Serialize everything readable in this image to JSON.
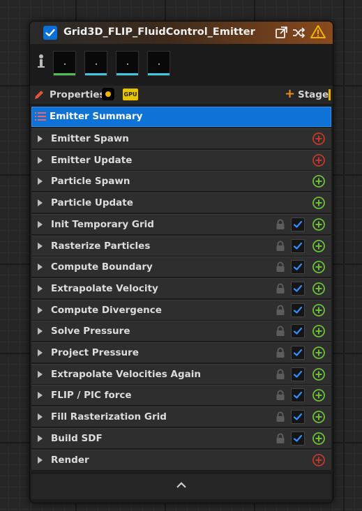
{
  "node": {
    "title": "Grid3D_FLIP_FluidControl_Emitter",
    "enabled": true,
    "header_icons": [
      "open-external-icon",
      "shuffle-icon",
      "warning-icon"
    ],
    "accent_color": "#0f72d6",
    "warning_color": "#f0b400"
  },
  "preview": {
    "person_icon": "person-icon",
    "textures": [
      {
        "bar_color": "#4fc04f"
      },
      {
        "bar_color": "#3fc6e0"
      },
      {
        "bar_color": "#3fc6e0"
      },
      {
        "bar_color": "#3fc6e0"
      }
    ]
  },
  "properties_bar": {
    "properties_label": "Properties",
    "gpu_badge": "GPU",
    "stage_label": "Stage"
  },
  "summary": {
    "label": "Emitter Summary"
  },
  "groups": [
    {
      "label": "Emitter Spawn",
      "add_color": "#c0392b",
      "lock": false,
      "checked": false
    },
    {
      "label": "Emitter Update",
      "add_color": "#c0392b",
      "lock": false,
      "checked": false
    },
    {
      "label": "Particle Spawn",
      "add_color": "#6dbf3a",
      "lock": false,
      "checked": false
    },
    {
      "label": "Particle Update",
      "add_color": "#6dbf3a",
      "lock": false,
      "checked": false
    },
    {
      "label": "Init Temporary Grid",
      "add_color": "#6dbf3a",
      "lock": true,
      "checked": true
    },
    {
      "label": "Rasterize Particles",
      "add_color": "#6dbf3a",
      "lock": true,
      "checked": true
    },
    {
      "label": "Compute Boundary",
      "add_color": "#6dbf3a",
      "lock": true,
      "checked": true
    },
    {
      "label": "Extrapolate Velocity",
      "add_color": "#6dbf3a",
      "lock": true,
      "checked": true
    },
    {
      "label": "Compute Divergence",
      "add_color": "#6dbf3a",
      "lock": true,
      "checked": true
    },
    {
      "label": "Solve Pressure",
      "add_color": "#6dbf3a",
      "lock": true,
      "checked": true
    },
    {
      "label": "Project Pressure",
      "add_color": "#6dbf3a",
      "lock": true,
      "checked": true
    },
    {
      "label": "Extrapolate Velocities Again",
      "add_color": "#6dbf3a",
      "lock": true,
      "checked": true
    },
    {
      "label": "FLIP / PIC force",
      "add_color": "#6dbf3a",
      "lock": true,
      "checked": true
    },
    {
      "label": "Fill Rasterization Grid",
      "add_color": "#6dbf3a",
      "lock": true,
      "checked": true
    },
    {
      "label": "Build SDF",
      "add_color": "#6dbf3a",
      "lock": true,
      "checked": true
    },
    {
      "label": "Render",
      "add_color": "#c0392b",
      "lock": false,
      "checked": false
    }
  ],
  "footer": {
    "collapse_icon": "chevron-up-icon"
  }
}
